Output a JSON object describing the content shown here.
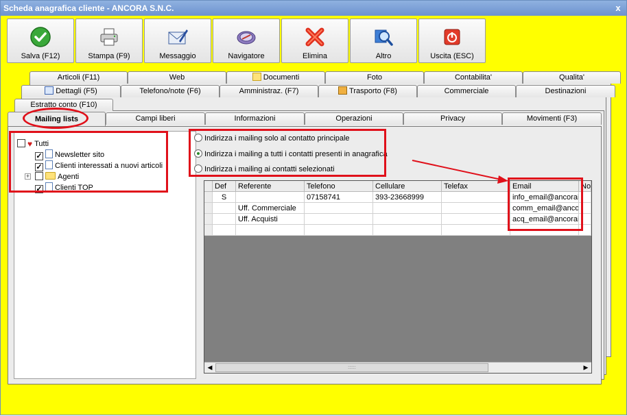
{
  "window": {
    "title": "Scheda anagrafica cliente - ANCORA S.N.C.",
    "close_glyph": "x"
  },
  "toolbar": [
    {
      "label": "Salva (F12)",
      "icon": "check-icon"
    },
    {
      "label": "Stampa (F9)",
      "icon": "printer-icon"
    },
    {
      "label": "Messaggio",
      "icon": "envelope-pen-icon"
    },
    {
      "label": "Navigatore",
      "icon": "compass-icon"
    },
    {
      "label": "Elimina",
      "icon": "delete-x-icon"
    },
    {
      "label": "Altro",
      "icon": "magnifier-icon"
    },
    {
      "label": "Uscita (ESC)",
      "icon": "power-icon"
    }
  ],
  "tabs": {
    "row1": [
      "Articoli (F11)",
      "Web",
      "Documenti",
      "Foto",
      "Contabilita'",
      "Qualita'"
    ],
    "row2": [
      "Dettagli (F5)",
      "Telefono/note (F6)",
      "Amministraz. (F7)",
      "Trasporto (F8)",
      "Commerciale",
      "Destinazioni"
    ],
    "row3": [
      "Estratto conto (F10)"
    ],
    "row4": [
      "Mailing lists",
      "Campi liberi",
      "Informazioni",
      "Operazioni",
      "Privacy",
      "Movimenti (F3)"
    ],
    "active": "Mailing lists"
  },
  "tree": {
    "root": {
      "label": "Tutti",
      "checked": false
    },
    "items": [
      {
        "label": "Newsletter sito",
        "checked": true,
        "type": "document"
      },
      {
        "label": "Clienti interessati a nuovi articoli",
        "checked": true,
        "type": "document"
      },
      {
        "label": "Agenti",
        "checked": false,
        "type": "folder",
        "expander": "+"
      },
      {
        "label": "Clienti TOP",
        "checked": true,
        "type": "document"
      }
    ]
  },
  "mailing_options": [
    {
      "label": "Indirizza i mailing solo al contatto principale",
      "selected": false
    },
    {
      "label": "Indirizza i mailing a tutti i contatti presenti in anagrafica",
      "selected": true
    },
    {
      "label": "Indirizza i mailing ai contatti selezionati",
      "selected": false
    }
  ],
  "grid": {
    "columns": [
      "Def",
      "Referente",
      "Telefono",
      "Cellulare",
      "Telefax",
      "Email",
      "Not"
    ],
    "rows": [
      [
        "S",
        "",
        "07158741",
        "393-23668999",
        "",
        "info_email@ancorair",
        ""
      ],
      [
        "",
        "Uff. Commerciale",
        "",
        "",
        "",
        "comm_email@ancor",
        ""
      ],
      [
        "",
        "Uff. Acquisti",
        "",
        "",
        "",
        "acq_email@ancorair",
        ""
      ],
      [
        "",
        "",
        "",
        "",
        "",
        "",
        ""
      ]
    ],
    "scroll_left": "◀",
    "scroll_right": "▶",
    "scroll_grip": "::::::"
  },
  "colors": {
    "background": "#ffff00",
    "highlight": "#e0101a"
  }
}
